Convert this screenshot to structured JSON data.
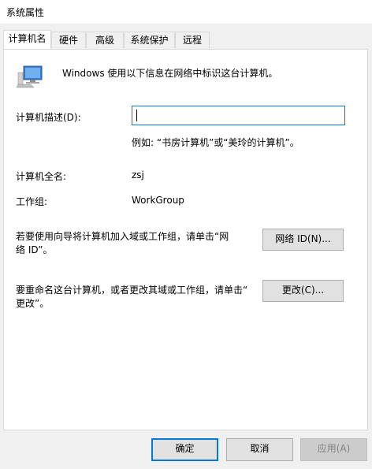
{
  "window": {
    "title": "系统属性"
  },
  "tabs": [
    {
      "label": "计算机名",
      "active": true
    },
    {
      "label": "硬件",
      "active": false
    },
    {
      "label": "高级",
      "active": false
    },
    {
      "label": "系统保护",
      "active": false
    },
    {
      "label": "远程",
      "active": false
    }
  ],
  "panel": {
    "intro": "Windows 使用以下信息在网络中标识这台计算机。",
    "description_label": "计算机描述(D):",
    "description_value": "",
    "description_example": "例如: “书房计算机”或“美玲的计算机”。",
    "fullname_label": "计算机全名:",
    "fullname_value": "zsj",
    "workgroup_label": "工作组:",
    "workgroup_value": "WorkGroup",
    "network_id_text_1": "若要使用向导将计算机加入域或工作组，请单击“网",
    "network_id_text_2": "络 ID”。",
    "network_id_button": "网络 ID(N)...",
    "rename_text_1": "要重命名这台计算机，或者更改其域或工作组，请单击“",
    "rename_text_2": "更改”。",
    "change_button": "更改(C)..."
  },
  "footer": {
    "ok": "确定",
    "cancel": "取消",
    "apply": "应用(A)"
  },
  "colors": {
    "accent": "#0078d7",
    "button_bg": "#e1e1e1",
    "disabled_bg": "#cccccc"
  }
}
